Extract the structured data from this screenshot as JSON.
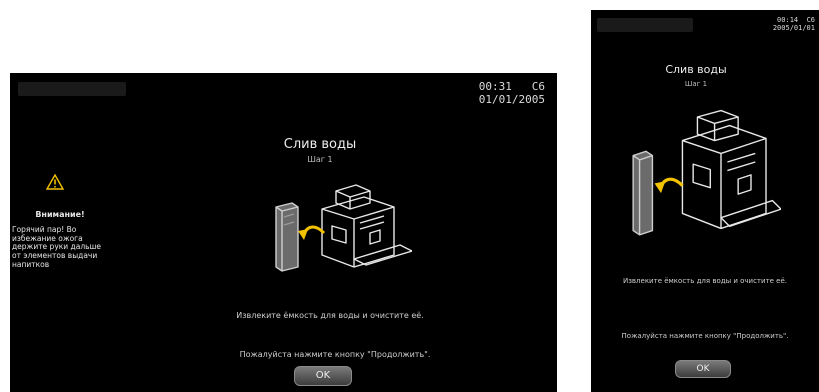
{
  "screen_large": {
    "datetime": {
      "time": "00:31",
      "code": "C6",
      "date": "01/01/2005"
    },
    "title": "Слив воды",
    "step": "Шаг 1",
    "warning": {
      "icon": "warning-icon",
      "heading": "Внимание!",
      "text": "Горячий пар! Во избежание ожога держите руки дальше от элементов выдачи напитков"
    },
    "instruction": "Извлеките ёмкость для воды и очистите её.",
    "prompt": "Пожалуйста нажмите кнопку \"Продолжить\".",
    "ok_label": "OK"
  },
  "screen_small": {
    "datetime": {
      "time": "00:14",
      "code": "C6",
      "date": "2005/01/01"
    },
    "title": "Слив воды",
    "step": "Шаг 1",
    "instruction": "Извлеките ёмкость для воды и очистите её.",
    "prompt": "Пожалуйста нажмите кнопку \"Продолжить\".",
    "ok_label": "OK"
  },
  "colors": {
    "screen_bg": "#000000",
    "arrow": "#f2c200",
    "line": "#e8e8e8"
  }
}
